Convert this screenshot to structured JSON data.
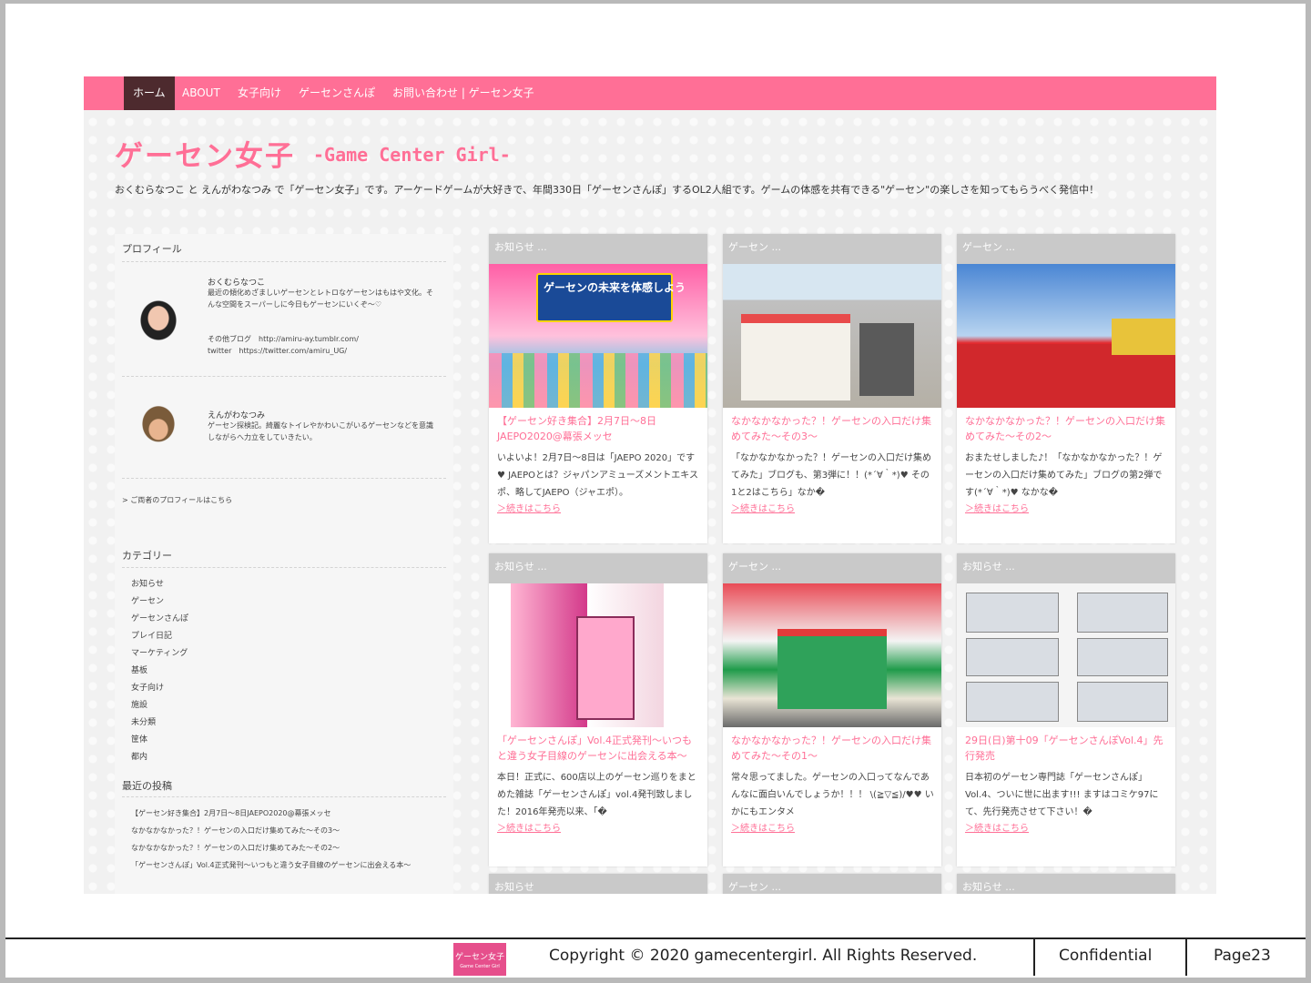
{
  "nav": {
    "items": [
      "ホーム",
      "ABOUT",
      "女子向け",
      "ゲーセンさんぽ",
      "お問い合わせ | ゲーセン女子"
    ]
  },
  "site": {
    "title_ja": "ゲーセン女子",
    "title_en": "-Game Center Girl-",
    "description": "おくむらなつこ と えんがわなつみ で「ゲーセン女子」です。アーケードゲームが大好きで、年間330日「ゲーセンさんぽ」するOL2人組です。ゲームの体感を共有できる\"ゲーセン\"の楽しさを知ってもらうべく発信中！"
  },
  "sidebar": {
    "profile_heading": "プロフィール",
    "profiles": [
      {
        "name": "おくむらなつこ",
        "text": "最近の傾化めざましいゲーセンとレトロなゲーセンはもはや文化。そんな空間をスーパーしに今日もゲーセンにいくぞ〜♡",
        "blog": "その他ブログ　http://amiru-ay.tumblr.com/",
        "twitter": "twitter　https://twitter.com/amiru_UG/"
      },
      {
        "name": "えんがわなつみ",
        "text": "ゲーセン探検記。綺麗なトイレやかわいこがいるゲーセンなどを意識しながらへ力立をしていきたい。"
      }
    ],
    "profile_more": "> ご両者のプロフィールはこちら",
    "category_heading": "カテゴリー",
    "categories": [
      "お知らせ",
      "ゲーセン",
      "ゲーセンさんぽ",
      "プレイ日記",
      "マーケティング",
      "基板",
      "女子向け",
      "施設",
      "未分類",
      "筐体",
      "都内"
    ],
    "recent_heading": "最近の投稿",
    "recent": [
      "【ゲーセン好き集合】2月7日〜8日JAEPO2020@幕張メッセ",
      "なかなかなかった？！ゲーセンの入口だけ集めてみた〜その3〜",
      "なかなかなかった？！ゲーセンの入口だけ集めてみた〜その2〜",
      "「ゲーセンさんぽ」Vol.4正式発刊〜いつもと違う女子目線のゲーセンに出会える本〜"
    ]
  },
  "cards": [
    {
      "tag": "お知らせ ...",
      "title": "【ゲーセン好き集合】2月7日〜8日JAEPO2020@幕張メッセ",
      "excerpt": "いよいよ！2月7日〜8日は「JAEPO 2020」です♥ JAEPOとは？ジャパンアミューズメントエキスポ、略してJAEPO（ジャエポ）。",
      "more": "＞続きはこちら",
      "image_banner": "ゲーセンの未来を体感しよう"
    },
    {
      "tag": "ゲーセン ...",
      "title": "なかなかなかった？！ゲーセンの入口だけ集めてみた〜その3〜",
      "excerpt": "「なかなかなかった？！ゲーセンの入口だけ集めてみた」ブログも、第3弾に！！(*´∀｀*)♥ その1と2はこちら」なか�",
      "more": "＞続きはこちら"
    },
    {
      "tag": "ゲーセン ...",
      "title": "なかなかなかった？！ゲーセンの入口だけ集めてみた〜その2〜",
      "excerpt": "おまたせしました♪！「なかなかなかった？！ゲーセンの入口だけ集めてみた」ブログの第2弾です(*´∀｀*)♥ なかな�",
      "more": "＞続きはこちら"
    },
    {
      "tag": "お知らせ ...",
      "title": "「ゲーセンさんぽ」Vol.4正式発刊〜いつもと違う女子目線のゲーセンに出会える本〜",
      "excerpt": "本日！正式に、600店以上のゲーセン巡りをまとめた雑誌「ゲーセンさんぽ」vol.4発刊致しました！2016年発売以来、「�",
      "more": "＞続きはこちら"
    },
    {
      "tag": "ゲーセン ...",
      "title": "なかなかなかった？！ゲーセンの入口だけ集めてみた〜その1〜",
      "excerpt": "常々思ってました。ゲーセンの入口ってなんであんなに面白いんでしょうか！！！ \\(≧▽≦)/♥♥ いかにもエンタメ",
      "more": "＞続きはこちら"
    },
    {
      "tag": "お知らせ ...",
      "title": "29日(日)第十09「ゲーセンさんぽVol.4」先行発売",
      "excerpt": "日本初のゲーセン専門誌「ゲーセンさんぽ」Vol.4、ついに世に出ます!!! ますはコミケ97にて、先行発売させて下さい！�",
      "more": "＞続きはこちら"
    }
  ],
  "bottom_tags": [
    "お知らせ",
    "ゲーセン ...",
    "お知らせ ..."
  ],
  "footer": {
    "logo_line1": "ゲーセン女子",
    "logo_line2": "Game Center Girl",
    "copyright": "Copyright © 2020 gamecentergirl. All Rights Reserved.",
    "confidential": "Confidential",
    "page": "Page23"
  }
}
